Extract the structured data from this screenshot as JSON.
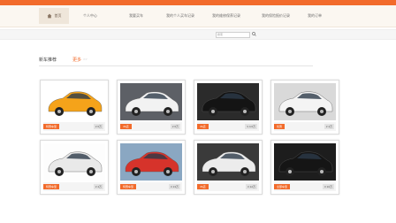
{
  "nav": {
    "home": "首页",
    "items": [
      "个人中心",
      "我要买车",
      "我的个人买车记录",
      "我的维修保养记录",
      "我的保险报价记录",
      "我的订单"
    ]
  },
  "search": {
    "placeholder": "搜索",
    "button_icon": "search-icon"
  },
  "section": {
    "title": "新车推荐",
    "more": "更多",
    "more_hint": ">>"
  },
  "cards": [
    {
      "tag": "特惠车型",
      "price": "¥ 6万",
      "car_color": "#f5a31a",
      "bg": "#ffffff",
      "icon": "yellow-sports-car"
    },
    {
      "tag": "4S店",
      "price": "¥ 6万",
      "car_color": "#f2f2f2",
      "bg": "#5d6066",
      "icon": "white-sedan"
    },
    {
      "tag": "4S店",
      "price": "¥ 4.6万",
      "car_color": "#141414",
      "bg": "#2b2b2b",
      "icon": "black-sedan"
    },
    {
      "tag": "优惠",
      "price": "¥ 4万",
      "car_color": "#f4f4f4",
      "bg": "#d9d9d9",
      "icon": "white-sedan-front"
    },
    {
      "tag": "特惠车型",
      "price": "¥ 4万",
      "car_color": "#e9e9e9",
      "bg": "#fdfdfd",
      "icon": "silver-coupe"
    },
    {
      "tag": "特惠车型",
      "price": "¥ 13万",
      "car_color": "#d6332b",
      "bg": "#8aa7c2",
      "icon": "red-convertible"
    },
    {
      "tag": "4S店",
      "price": "¥ 12万",
      "car_color": "#ececec",
      "bg": "#3a3a3a",
      "icon": "white-sedan"
    },
    {
      "tag": "全部车型",
      "price": "¥ 10万",
      "car_color": "#151515",
      "bg": "#1d1d1d",
      "icon": "black-sedan"
    }
  ]
}
